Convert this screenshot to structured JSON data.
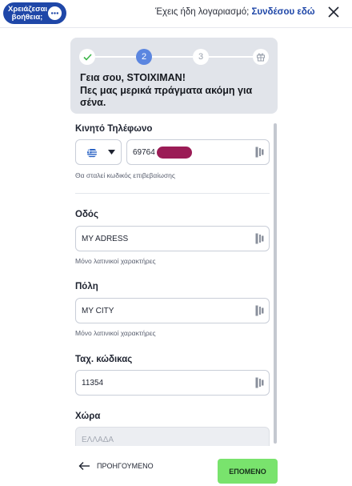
{
  "header": {
    "help_label": "Χρειάζεσαι βοήθεια;",
    "login_prompt": "Έχεις ήδη λογαριασμό;",
    "login_link": "Συνδέσου εδώ"
  },
  "stepper": {
    "steps": [
      {
        "label": "",
        "state": "done"
      },
      {
        "label": "2",
        "state": "active"
      },
      {
        "label": "3",
        "state": "todo"
      },
      {
        "label": "",
        "state": "todo"
      }
    ],
    "greeting_line1": "Γεια σου, STOIXIMAN!",
    "greeting_line2": "Πες μας μερικά πράγματα ακόμη για σένα."
  },
  "form": {
    "phone": {
      "label": "Κινητό Τηλέφωνο",
      "value": "69764",
      "hint": "Θα σταλεί κωδικός επιβεβαίωσης"
    },
    "street": {
      "label": "Οδός",
      "value": "MY ADRESS",
      "hint": "Μόνο λατινικοί χαρακτήρες"
    },
    "city": {
      "label": "Πόλη",
      "value": "MY CITY",
      "hint": "Μόνο λατινικοί χαρακτήρες"
    },
    "postal": {
      "label": "Ταχ. κώδικας",
      "value": "11354"
    },
    "country": {
      "label": "Χώρα",
      "value": "ΕΛΛΑΔΑ"
    }
  },
  "footer": {
    "prev_label": "ΠΡΟΗΓΟΥΜΕΝΟ",
    "next_label": "ΕΠΟΜΕΝΟ"
  },
  "colors": {
    "brand_blue": "#1f47a8",
    "active_step": "#5b86e0",
    "next_green": "#79e36d",
    "redaction": "#9b1c56"
  }
}
